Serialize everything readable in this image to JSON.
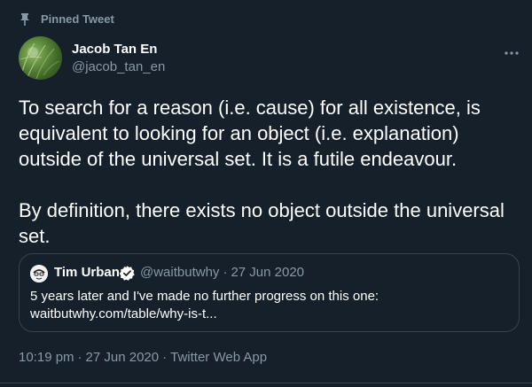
{
  "pinned": {
    "label": "Pinned Tweet",
    "icon": "pin-icon"
  },
  "author": {
    "name": "Jacob Tan En",
    "handle": "@jacob_tan_en",
    "avatar": "avatar"
  },
  "more_menu": {
    "icon": "more-horizontal-icon",
    "glyph": "···"
  },
  "tweet": {
    "text": "To search for a reason (i.e. cause) for all existence, is equivalent to looking for an object (i.e. explanation) outside of the universal set. It is a futile endeavour.\n\nBy definition, there exists no object outside the universal set."
  },
  "quote": {
    "name": "Tim Urban",
    "verified_icon": "verified-badge-icon",
    "handle": "@waitbutwhy",
    "separator": "·",
    "date": "27 Jun 2020",
    "text": "5 years later and I've made no further progress on this one:",
    "link": "waitbutwhy.com/table/why-is-t..."
  },
  "meta": {
    "time": "10:19 pm",
    "separator1": "·",
    "date": "27 Jun 2020",
    "separator2": "·",
    "source": "Twitter Web App"
  },
  "colors": {
    "background": "#15202b",
    "secondary_text": "#8899a6",
    "border": "#38444d",
    "verified": "#1da1f2"
  }
}
